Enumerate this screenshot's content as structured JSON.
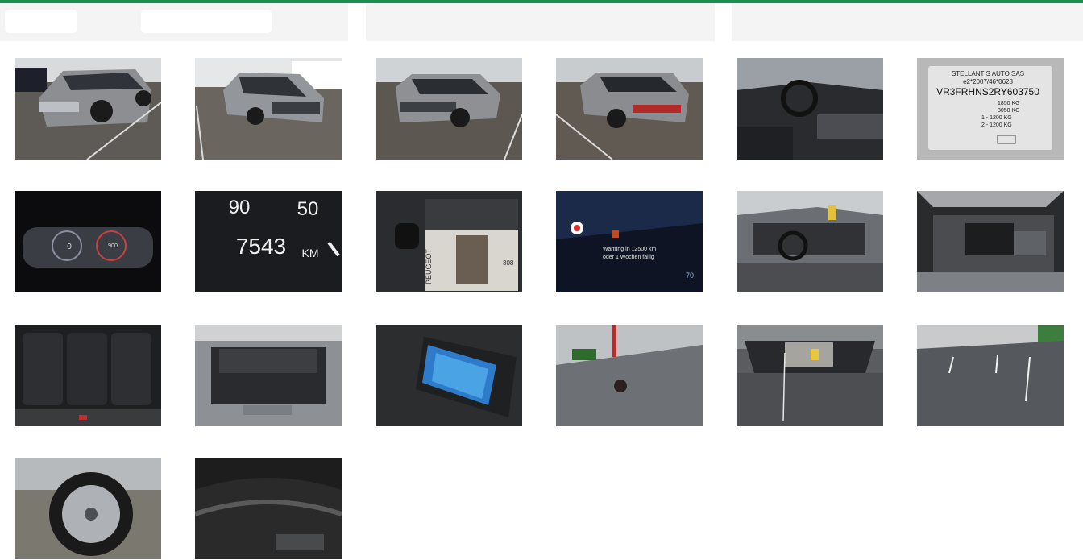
{
  "header": {
    "panels": [
      "left-panel",
      "middle-panel",
      "right-panel"
    ]
  },
  "gallery": {
    "photos": [
      {
        "id": "p1",
        "subject": "front-left exterior"
      },
      {
        "id": "p2",
        "subject": "front-right exterior"
      },
      {
        "id": "p3",
        "subject": "rear-left exterior"
      },
      {
        "id": "p4",
        "subject": "rear-left exterior 2"
      },
      {
        "id": "p5",
        "subject": "driver cockpit"
      },
      {
        "id": "p6",
        "subject": "vin plate"
      },
      {
        "id": "p7",
        "subject": "instrument cluster"
      },
      {
        "id": "p8",
        "subject": "odometer"
      },
      {
        "id": "p9",
        "subject": "key and manual"
      },
      {
        "id": "p10",
        "subject": "service message"
      },
      {
        "id": "p11",
        "subject": "interior dashboard"
      },
      {
        "id": "p12",
        "subject": "engine bay"
      },
      {
        "id": "p13",
        "subject": "rear seats"
      },
      {
        "id": "p14",
        "subject": "trunk"
      },
      {
        "id": "p15",
        "subject": "tire repair kit"
      },
      {
        "id": "p16",
        "subject": "hood close-up"
      },
      {
        "id": "p17",
        "subject": "windshield"
      },
      {
        "id": "p18",
        "subject": "roof"
      },
      {
        "id": "p19",
        "subject": "wheel"
      },
      {
        "id": "p20",
        "subject": "tire sidewall"
      }
    ]
  },
  "odometer": {
    "speed_a": "90",
    "speed_b": "50",
    "km_value": "7543",
    "km_unit": "KM"
  },
  "cluster": {
    "left_value": "0",
    "right_value": "900"
  },
  "vin_plate": {
    "line1": "STELLANTIS AUTO SAS",
    "line2": "e2*2007/46*0628",
    "vin": "VR3FRHNS2RY603750",
    "w1": "1850 KG",
    "w2": "3050 KG",
    "w3": "1 - 1200 KG",
    "w4": "2 - 1200 KG"
  },
  "manual": {
    "brand": "PEUGEOT",
    "model": "308"
  },
  "service": {
    "line1": "Wartung in 12500 km",
    "line2": "oder 1 Wochen fällig",
    "speed": "70"
  },
  "colors": {
    "accent": "#1a8f4f",
    "header_bg": "#f4f4f4"
  }
}
